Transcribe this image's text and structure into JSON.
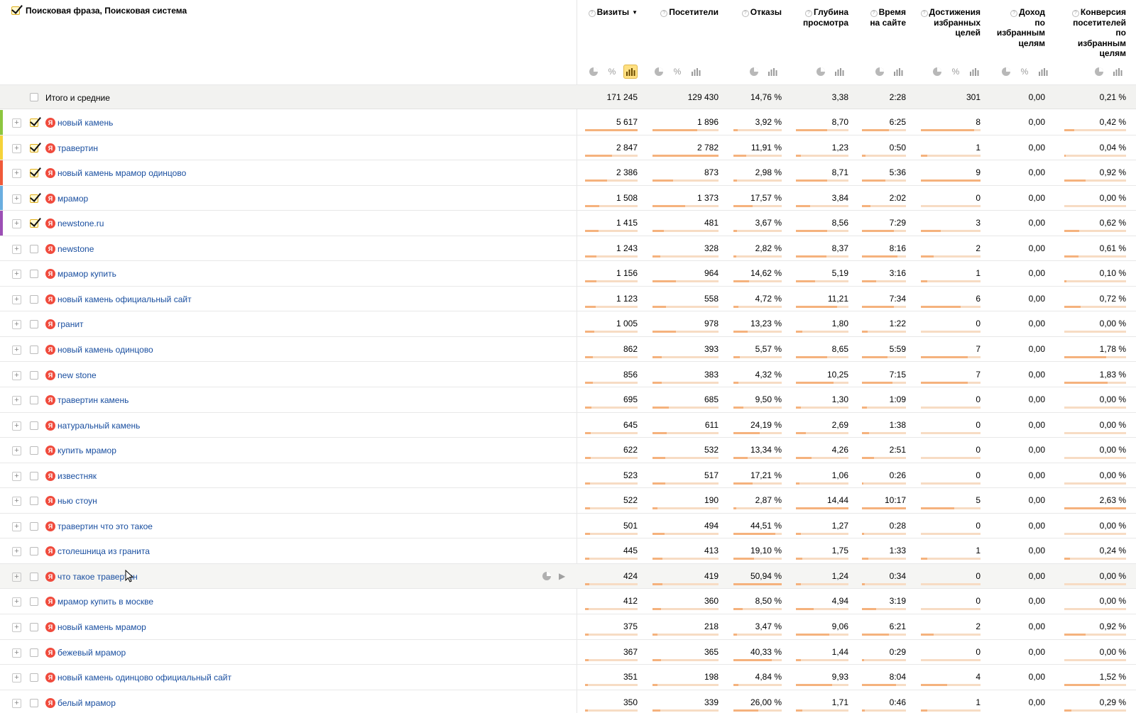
{
  "dimension_header": {
    "label": "Поисковая фраза, Поисковая система",
    "checked": true
  },
  "columns": [
    {
      "key": "visits",
      "label_lines": [
        "Визиты"
      ],
      "sort_arrow": "▼",
      "icons": [
        "pie",
        "percent",
        "bars-active"
      ]
    },
    {
      "key": "visitors",
      "label_lines": [
        "Посетители"
      ],
      "icons": [
        "pie",
        "percent",
        "bars"
      ]
    },
    {
      "key": "bounce",
      "label_lines": [
        "Отказы"
      ],
      "icons": [
        "pie",
        "bars"
      ]
    },
    {
      "key": "depth",
      "label_lines": [
        "Глубина",
        "просмотра"
      ],
      "icons": [
        "pie",
        "bars"
      ]
    },
    {
      "key": "time",
      "label_lines": [
        "Время",
        "на сайте"
      ],
      "icons": [
        "pie",
        "bars"
      ]
    },
    {
      "key": "goals",
      "label_lines": [
        "Достижения",
        "избранных",
        "целей"
      ],
      "icons": [
        "pie",
        "percent",
        "bars"
      ]
    },
    {
      "key": "revenue",
      "label_lines": [
        "Доход",
        "по",
        "избранным",
        "целям"
      ],
      "icons": [
        "pie",
        "percent",
        "bars"
      ]
    },
    {
      "key": "conversion",
      "label_lines": [
        "Конверсия",
        "посетителей",
        "по",
        "избранным",
        "целям"
      ],
      "icons": [
        "pie",
        "bars"
      ]
    }
  ],
  "totals": {
    "label": "Итого и средние",
    "values": [
      "171 245",
      "129 430",
      "14,76 %",
      "3,38",
      "2:28",
      "301",
      "0,00",
      "0,21 %"
    ]
  },
  "rows": [
    {
      "phrase": "новый камень",
      "checked": true,
      "stripe": "#8dc63f",
      "values": [
        "5 617",
        "1 896",
        "3,92 %",
        "8,70",
        "6:25",
        "8",
        "0,00",
        "0,42 %"
      ],
      "fill": [
        1.0,
        0.68,
        0.09,
        0.6,
        0.62,
        0.89,
        0,
        0.16
      ]
    },
    {
      "phrase": "травертин",
      "checked": true,
      "stripe": "#f5d33a",
      "values": [
        "2 847",
        "2 782",
        "11,91 %",
        "1,23",
        "0:50",
        "1",
        "0,00",
        "0,04 %"
      ],
      "fill": [
        0.51,
        1.0,
        0.27,
        0.09,
        0.08,
        0.11,
        0,
        0.02
      ]
    },
    {
      "phrase": "новый камень мрамор одинцово",
      "checked": true,
      "stripe": "#f05a3a",
      "values": [
        "2 386",
        "873",
        "2,98 %",
        "8,71",
        "5:36",
        "9",
        "0,00",
        "0,92 %"
      ],
      "fill": [
        0.42,
        0.31,
        0.07,
        0.6,
        0.54,
        1.0,
        0,
        0.35
      ]
    },
    {
      "phrase": "мрамор",
      "checked": true,
      "stripe": "#6aaee0",
      "values": [
        "1 508",
        "1 373",
        "17,57 %",
        "3,84",
        "2:02",
        "0",
        "0,00",
        "0,00 %"
      ],
      "fill": [
        0.27,
        0.49,
        0.39,
        0.27,
        0.2,
        0,
        0,
        0
      ]
    },
    {
      "phrase": "newstone.ru",
      "checked": true,
      "stripe": "#9c4fb5",
      "values": [
        "1 415",
        "481",
        "3,67 %",
        "8,56",
        "7:29",
        "3",
        "0,00",
        "0,62 %"
      ],
      "fill": [
        0.25,
        0.17,
        0.08,
        0.59,
        0.72,
        0.33,
        0,
        0.24
      ]
    },
    {
      "phrase": "newstone",
      "checked": false,
      "stripe": "",
      "values": [
        "1 243",
        "328",
        "2,82 %",
        "8,37",
        "8:16",
        "2",
        "0,00",
        "0,61 %"
      ],
      "fill": [
        0.22,
        0.12,
        0.06,
        0.58,
        0.8,
        0.22,
        0,
        0.23
      ]
    },
    {
      "phrase": "мрамор купить",
      "checked": false,
      "stripe": "",
      "values": [
        "1 156",
        "964",
        "14,62 %",
        "5,19",
        "3:16",
        "1",
        "0,00",
        "0,10 %"
      ],
      "fill": [
        0.21,
        0.35,
        0.33,
        0.36,
        0.32,
        0.11,
        0,
        0.04
      ]
    },
    {
      "phrase": "новый камень официальный сайт",
      "checked": false,
      "stripe": "",
      "values": [
        "1 123",
        "558",
        "4,72 %",
        "11,21",
        "7:34",
        "6",
        "0,00",
        "0,72 %"
      ],
      "fill": [
        0.2,
        0.2,
        0.11,
        0.78,
        0.73,
        0.67,
        0,
        0.27
      ]
    },
    {
      "phrase": "гранит",
      "checked": false,
      "stripe": "",
      "values": [
        "1 005",
        "978",
        "13,23 %",
        "1,80",
        "1:22",
        "0",
        "0,00",
        "0,00 %"
      ],
      "fill": [
        0.18,
        0.35,
        0.3,
        0.12,
        0.13,
        0,
        0,
        0
      ]
    },
    {
      "phrase": "новый камень одинцово",
      "checked": false,
      "stripe": "",
      "values": [
        "862",
        "393",
        "5,57 %",
        "8,65",
        "5:59",
        "7",
        "0,00",
        "1,78 %"
      ],
      "fill": [
        0.15,
        0.14,
        0.13,
        0.6,
        0.58,
        0.78,
        0,
        0.68
      ]
    },
    {
      "phrase": "new stone",
      "checked": false,
      "stripe": "",
      "values": [
        "856",
        "383",
        "4,32 %",
        "10,25",
        "7:15",
        "7",
        "0,00",
        "1,83 %"
      ],
      "fill": [
        0.15,
        0.14,
        0.1,
        0.71,
        0.7,
        0.78,
        0,
        0.7
      ]
    },
    {
      "phrase": "травертин камень",
      "checked": false,
      "stripe": "",
      "values": [
        "695",
        "685",
        "9,50 %",
        "1,30",
        "1:09",
        "0",
        "0,00",
        "0,00 %"
      ],
      "fill": [
        0.12,
        0.25,
        0.21,
        0.09,
        0.11,
        0,
        0,
        0
      ]
    },
    {
      "phrase": "натуральный камень",
      "checked": false,
      "stripe": "",
      "values": [
        "645",
        "611",
        "24,19 %",
        "2,69",
        "1:38",
        "0",
        "0,00",
        "0,00 %"
      ],
      "fill": [
        0.11,
        0.22,
        0.54,
        0.19,
        0.16,
        0,
        0,
        0
      ]
    },
    {
      "phrase": "купить мрамор",
      "checked": false,
      "stripe": "",
      "values": [
        "622",
        "532",
        "13,34 %",
        "4,26",
        "2:51",
        "0",
        "0,00",
        "0,00 %"
      ],
      "fill": [
        0.11,
        0.19,
        0.3,
        0.3,
        0.28,
        0,
        0,
        0
      ]
    },
    {
      "phrase": "известняк",
      "checked": false,
      "stripe": "",
      "values": [
        "523",
        "517",
        "17,21 %",
        "1,06",
        "0:26",
        "0",
        "0,00",
        "0,00 %"
      ],
      "fill": [
        0.09,
        0.19,
        0.39,
        0.07,
        0.04,
        0,
        0,
        0
      ]
    },
    {
      "phrase": "нью стоун",
      "checked": false,
      "stripe": "",
      "values": [
        "522",
        "190",
        "2,87 %",
        "14,44",
        "10:17",
        "5",
        "0,00",
        "2,63 %"
      ],
      "fill": [
        0.09,
        0.07,
        0.06,
        1.0,
        1.0,
        0.56,
        0,
        1.0
      ]
    },
    {
      "phrase": "травертин что это такое",
      "checked": false,
      "stripe": "",
      "values": [
        "501",
        "494",
        "44,51 %",
        "1,27",
        "0:28",
        "0",
        "0,00",
        "0,00 %"
      ],
      "fill": [
        0.09,
        0.18,
        0.87,
        0.09,
        0.05,
        0,
        0,
        0
      ]
    },
    {
      "phrase": "столешница из гранита",
      "checked": false,
      "stripe": "",
      "values": [
        "445",
        "413",
        "19,10 %",
        "1,75",
        "1:33",
        "1",
        "0,00",
        "0,24 %"
      ],
      "fill": [
        0.08,
        0.15,
        0.43,
        0.12,
        0.15,
        0.11,
        0,
        0.09
      ]
    },
    {
      "phrase": "что такое травертин",
      "checked": false,
      "stripe": "",
      "hover": true,
      "values": [
        "424",
        "419",
        "50,94 %",
        "1,24",
        "0:34",
        "0",
        "0,00",
        "0,00 %"
      ],
      "fill": [
        0.08,
        0.15,
        1.0,
        0.09,
        0.06,
        0,
        0,
        0
      ]
    },
    {
      "phrase": "мрамор купить в москве",
      "checked": false,
      "stripe": "",
      "values": [
        "412",
        "360",
        "8,50 %",
        "4,94",
        "3:19",
        "0",
        "0,00",
        "0,00 %"
      ],
      "fill": [
        0.07,
        0.13,
        0.19,
        0.34,
        0.32,
        0,
        0,
        0
      ]
    },
    {
      "phrase": "новый камень мрамор",
      "checked": false,
      "stripe": "",
      "values": [
        "375",
        "218",
        "3,47 %",
        "9,06",
        "6:21",
        "2",
        "0,00",
        "0,92 %"
      ],
      "fill": [
        0.07,
        0.08,
        0.08,
        0.63,
        0.62,
        0.22,
        0,
        0.35
      ]
    },
    {
      "phrase": "бежевый мрамор",
      "checked": false,
      "stripe": "",
      "values": [
        "367",
        "365",
        "40,33 %",
        "1,44",
        "0:29",
        "0",
        "0,00",
        "0,00 %"
      ],
      "fill": [
        0.07,
        0.13,
        0.79,
        0.1,
        0.05,
        0,
        0,
        0
      ]
    },
    {
      "phrase": "новый камень одинцово официальный сайт",
      "checked": false,
      "stripe": "",
      "values": [
        "351",
        "198",
        "4,84 %",
        "9,93",
        "8:04",
        "4",
        "0,00",
        "1,52 %"
      ],
      "fill": [
        0.06,
        0.07,
        0.11,
        0.69,
        0.78,
        0.44,
        0,
        0.58
      ]
    },
    {
      "phrase": "белый мрамор",
      "checked": false,
      "stripe": "",
      "values": [
        "350",
        "339",
        "26,00 %",
        "1,71",
        "0:46",
        "1",
        "0,00",
        "0,29 %"
      ],
      "fill": [
        0.06,
        0.12,
        0.51,
        0.12,
        0.07,
        0.11,
        0,
        0.11
      ]
    }
  ],
  "colors": {
    "bar_track": "#f7dcc4",
    "bar_fill": "#f5b27d",
    "link": "#1a4fa0",
    "search_engine_badge": "#f04b3d"
  },
  "search_engine_badge_letter": "Я"
}
